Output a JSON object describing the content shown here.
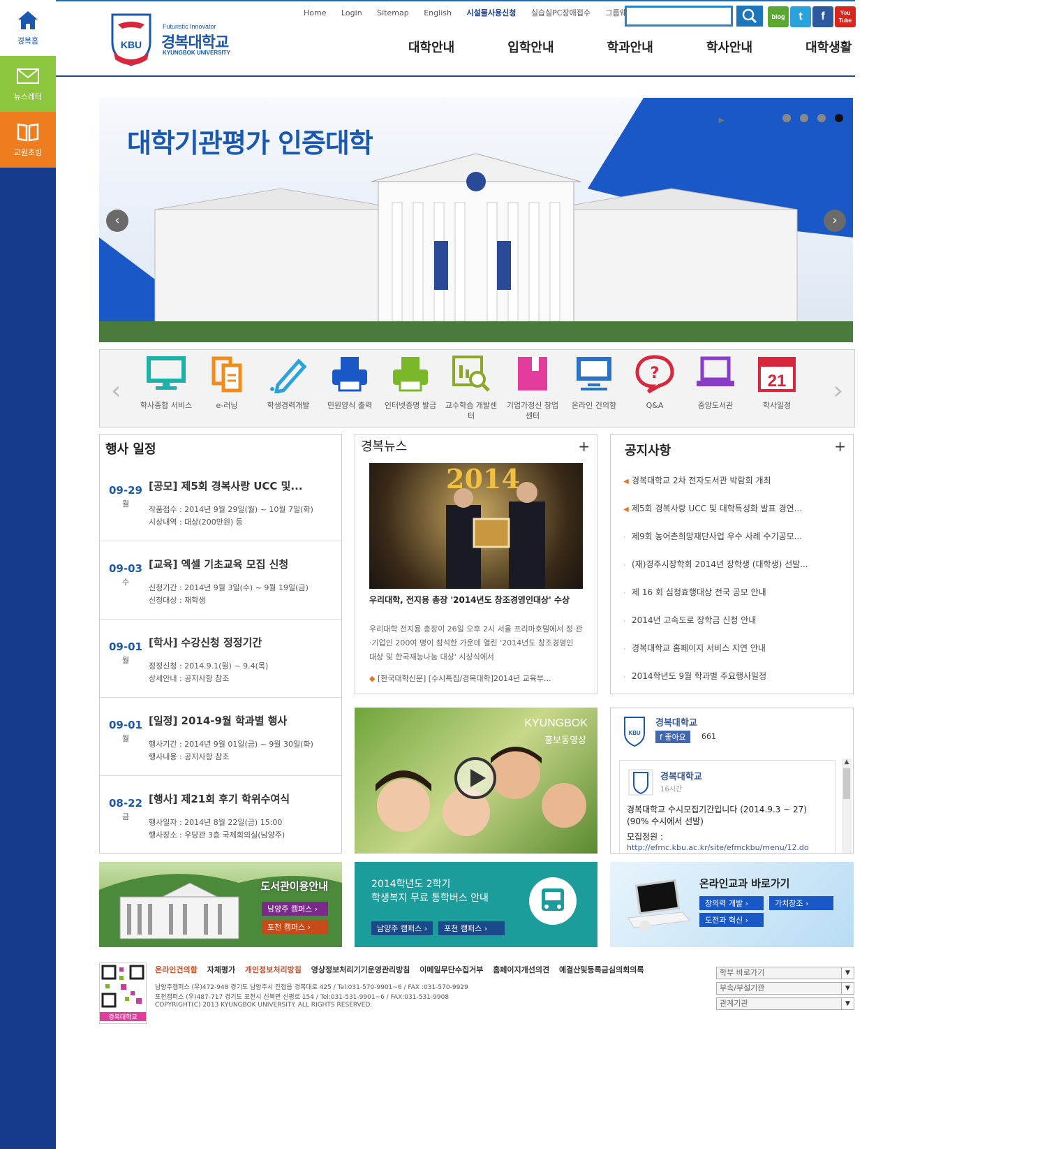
{
  "sidebar": {
    "items": [
      {
        "label": "경복홈",
        "icon": "home-icon"
      },
      {
        "label": "뉴스레터",
        "icon": "mail-icon"
      },
      {
        "label": "교원초빙",
        "icon": "book-icon"
      }
    ]
  },
  "header": {
    "logo_tagline": "Futuristic Innovator",
    "logo_name": "경복대학교",
    "logo_en": "KYUNGBOK UNIVERSITY",
    "logo_badge": "KBU",
    "util_links": [
      "Home",
      "Login",
      "Sitemap",
      "English",
      "시설물사용신청",
      "실습실PC장애접수",
      "그룹웨어"
    ],
    "search_placeholder": "",
    "sns": [
      {
        "label": "blog",
        "color": "#5aa830"
      },
      {
        "label": "t",
        "color": "#2aa3dd"
      },
      {
        "label": "f",
        "color": "#2c5aa0"
      },
      {
        "label": "You Tube",
        "color": "#d8261e"
      }
    ],
    "nav": [
      "대학안내",
      "입학안내",
      "학과안내",
      "학사안내",
      "대학생활"
    ]
  },
  "banner": {
    "title": "대학기관평가 인증대학",
    "slides": 4,
    "active_slide": 4
  },
  "quick_menu": [
    {
      "label": "학사종합 서비스",
      "icon": "monitor-icon",
      "color": "#1bb2a8"
    },
    {
      "label": "e-러닝",
      "icon": "documents-icon",
      "color": "#f08c1a"
    },
    {
      "label": "학생경력개발",
      "icon": "pencil-icon",
      "color": "#2aa3dd"
    },
    {
      "label": "민원양식 출력",
      "icon": "printer-icon",
      "color": "#1a58c8"
    },
    {
      "label": "인터넷증명 발급",
      "icon": "printer-green-icon",
      "color": "#7ab82a"
    },
    {
      "label": "교수학습 개발센터",
      "icon": "chart-search-icon",
      "color": "#8ca82a"
    },
    {
      "label": "기업가정신 창업센터",
      "icon": "book-pink-icon",
      "color": "#e23c9c"
    },
    {
      "label": "온라인 건의함",
      "icon": "screen-icon",
      "color": "#2a72c8"
    },
    {
      "label": "Q&A",
      "icon": "question-bubble-icon",
      "color": "#d8263c"
    },
    {
      "label": "중앙도서관",
      "icon": "laptop-icon",
      "color": "#8a3cc8"
    },
    {
      "label": "학사일정",
      "icon": "calendar-icon",
      "color": "#d8263c",
      "number": "21"
    }
  ],
  "events": {
    "title": "행사 일정",
    "items": [
      {
        "date": "09-29",
        "day": "월",
        "title": "[공모] 제5회 경복사랑 UCC 및...",
        "line1": "작품접수 : 2014년 9월 29일(월) ~ 10월 7일(화)",
        "line2": "시상내역 : 대상(200만원) 등"
      },
      {
        "date": "09-03",
        "day": "수",
        "title": "[교육] 엑셀 기초교육 모집 신청",
        "line1": "신청기간 : 2014년 9월 3일(수) ~ 9월 19일(금)",
        "line2": "신청대상 : 재학생"
      },
      {
        "date": "09-01",
        "day": "월",
        "title": "[학사] 수강신청 정정기간",
        "line1": "정정신청 : 2014.9.1(월) ~ 9.4(목)",
        "line2": "상세안내 : 공지사항 참조"
      },
      {
        "date": "09-01",
        "day": "월",
        "title": "[일정] 2014-9월 학과별 행사",
        "line1": "행사기간 : 2014년 9월 01일(금) ~ 9월 30일(화)",
        "line2": "행사내용 : 공지사항 참조"
      },
      {
        "date": "08-22",
        "day": "금",
        "title": "[행사] 제21회 후기 학위수여식",
        "line1": "행사일자 : 2014년 8월 22일(금) 15:00",
        "line2": "행사장소 : 우당관 3층 국제회의실(남양주)"
      }
    ]
  },
  "news": {
    "title": "경복뉴스",
    "more": "+",
    "image_year": "2014",
    "headline": "우리대학, 전지용 총장 '2014년도 창조경영인대상' 수상",
    "body": "우리대학 전지용 총장이 26일 오후 2시 서울 프리마호텔에서 정·관·기업인 200여 명이 참석한 가운데 열린 '2014년도 창조경영인 대상 및 한국재능나눔 대상' 시상식에서",
    "link": "[한국대학신문] [수시특집/경복대학]2014년 교육부..."
  },
  "notices": {
    "title": "공지사항",
    "more": "+",
    "items": [
      {
        "text": "경복대학교 2차 전자도서관 박람회 개최",
        "new": true
      },
      {
        "text": "제5회 경복사랑 UCC 및 대학특성화 발표 경연...",
        "new": true
      },
      {
        "text": "제9회 농어촌희망재단사업 우수 사례 수기공모...",
        "new": false
      },
      {
        "text": "(재)경주시장학회 2014년 장학생 (대학생) 선발...",
        "new": false
      },
      {
        "text": "제 16 회 심청효행대상 전국 공모 안내",
        "new": false
      },
      {
        "text": "2014년 고속도로 장학금 신청 안내",
        "new": false
      },
      {
        "text": "경복대학교 홈페이지 서비스 지연 안내",
        "new": false
      },
      {
        "text": "2014학년도 9월 학과별 주요행사일정",
        "new": false
      }
    ]
  },
  "video": {
    "title": "KYUNGBOK",
    "subtitle": "홍보동영상"
  },
  "facebook": {
    "page_name": "경복대학교",
    "like_label": "좋아요",
    "like_count": "661",
    "post_author": "경복대학교",
    "post_time": "16시간",
    "post_text": "경복대학교 수시모집기간입니다 (2014.9.3 ~ 27) (90% 수시에서 선발)",
    "post_text2": "모집정원 :",
    "post_link": "http://efmc.kbu.ac.kr/site/efmckbu/menu/12.do"
  },
  "banners": {
    "library": {
      "title": "도서관이용안내",
      "btn1": "남양주 캠퍼스",
      "btn2": "포천 캠퍼스"
    },
    "bus": {
      "line1": "2014학년도 2학기",
      "line2": "학생복지 무료 통학버스 안내",
      "btn1": "남양주 캠퍼스",
      "btn2": "포천 캠퍼스"
    },
    "online": {
      "title": "온라인교과 바로가기",
      "btn1": "창의력 개발",
      "btn2": "가치창조",
      "btn3": "도전과 혁신"
    }
  },
  "footer": {
    "qr_label": "경복대학교",
    "links": [
      "온라인건의함",
      "자체평가",
      "개인정보처리방침",
      "영상정보처리기기운영관리방침",
      "이메일무단수집거부",
      "홈페이지개선의견",
      "예결산및등록금심의회의록"
    ],
    "addr1": "남양주캠퍼스    (우)472-948 경기도 남양주시 진접읍 경복대로 425 / Tel:031-570-9901~6 / FAX :031-570-9929",
    "addr2": "포천캠퍼스      (우)487-717 경기도 포천시 신북면 신평로 154 / Tel:031-531-9901~6 / FAX:031-531-9908",
    "copyright": "COPYRIGHT(C) 2013 KYUNGBOK UNIVERSITY. ALL RIGHTS RESERVED.",
    "selects": [
      "학부 바로가기",
      "부속/부설기관",
      "관계기관"
    ]
  }
}
